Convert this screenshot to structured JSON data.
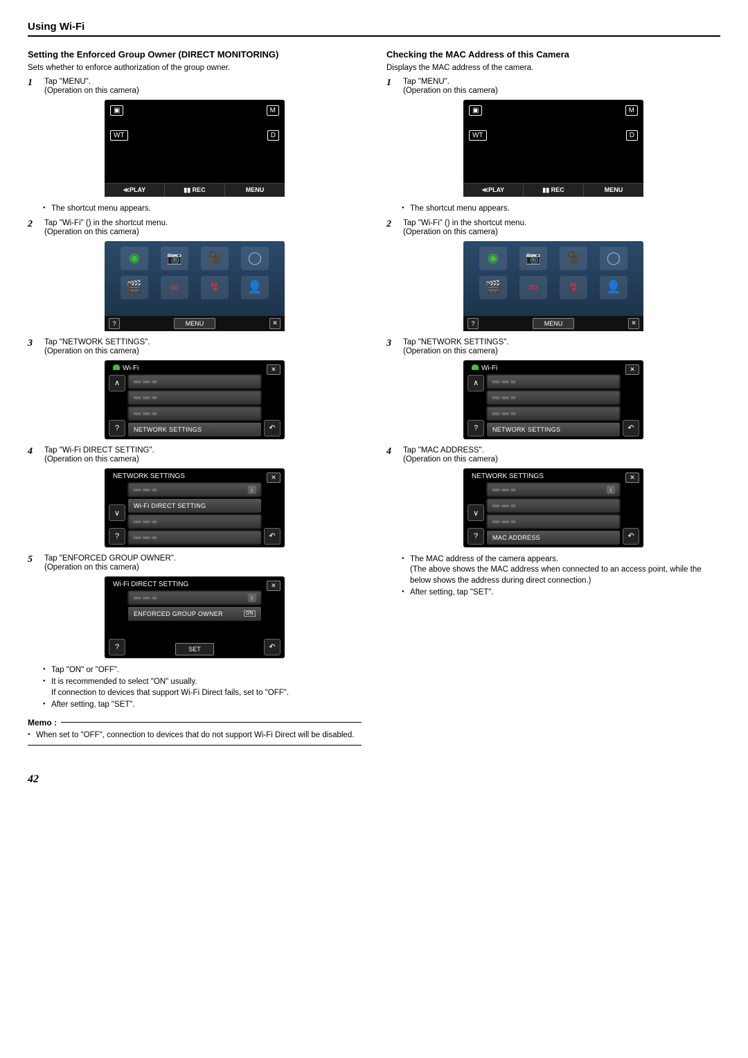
{
  "header": "Using Wi-Fi",
  "pageNum": "42",
  "left": {
    "title": "Setting the Enforced Group Owner (DIRECT MONITORING)",
    "desc": "Sets whether to enforce authorization of the group owner.",
    "step1a": "Tap \"MENU\".",
    "step1b": "(Operation on this camera)",
    "mainBtnPlay": "≪PLAY",
    "mainBtnRec": "▮▮ REC",
    "mainBtnMenu": "MENU",
    "cImg": "▣",
    "cM": "M",
    "cWT": "WT",
    "cD": "D",
    "bullet1": "The shortcut menu appears.",
    "step2a": "Tap \"Wi-Fi\" () in the shortcut menu.",
    "step2b": "(Operation on this camera)",
    "scMenu": "MENU",
    "step3a": "Tap \"NETWORK SETTINGS\".",
    "step3b": "(Operation on this camera)",
    "wifiTitle": "Wi-Fi",
    "netSettings": "NETWORK SETTINGS",
    "step4a": "Tap \"Wi-Fi DIRECT SETTING\".",
    "step4b": "(Operation on this camera)",
    "netTitle": "NETWORK SETTINGS",
    "wifiDirect": "Wi-Fi DIRECT SETTING",
    "step5a": "Tap \"ENFORCED GROUP OWNER\".",
    "step5b": "(Operation on this camera)",
    "dirTitle": "Wi-Fi DIRECT SETTING",
    "enforced": "ENFORCED GROUP OWNER",
    "on": "ON",
    "set": "SET",
    "bullet5a": "Tap \"ON\" or \"OFF\".",
    "bullet5b": "It is recommended to select \"ON\" usually.",
    "bullet5b2": "If connection to devices that support Wi-Fi Direct fails, set to \"OFF\".",
    "bullet5c": "After setting, tap \"SET\".",
    "memoTitle": "Memo :",
    "memo1": "When set to \"OFF\", connection to devices that do not support Wi-Fi Direct will be disabled."
  },
  "right": {
    "title": "Checking the MAC Address of this Camera",
    "desc": "Displays the MAC address of the camera.",
    "step1a": "Tap \"MENU\".",
    "step1b": "(Operation on this camera)",
    "bullet1": "The shortcut menu appears.",
    "step2a": "Tap \"Wi-Fi\" () in the shortcut menu.",
    "step2b": "(Operation on this camera)",
    "step3a": "Tap \"NETWORK SETTINGS\".",
    "step3b": "(Operation on this camera)",
    "step4a": "Tap \"MAC ADDRESS\".",
    "step4b": "(Operation on this camera)",
    "macAddress": "MAC ADDRESS",
    "bullet4a": "The MAC address of the camera appears.",
    "bullet4a2": "(The above shows the MAC address when connected to an access point, while the below shows the address during direct connection.)",
    "bullet4b": "After setting, tap \"SET\"."
  }
}
